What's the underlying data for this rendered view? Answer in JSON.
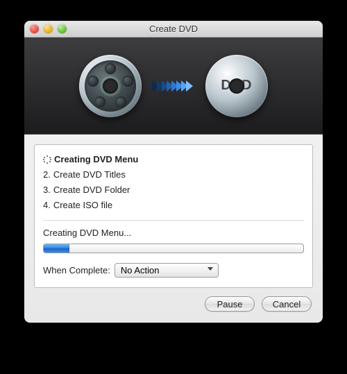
{
  "window": {
    "title": "Create DVD"
  },
  "hero": {
    "dvd_label": "DVD"
  },
  "steps": {
    "items": [
      {
        "prefix": "",
        "label": "Creating DVD Menu",
        "active": true
      },
      {
        "prefix": "2.",
        "label": "Create DVD Titles",
        "active": false
      },
      {
        "prefix": "3.",
        "label": "Create DVD Folder",
        "active": false
      },
      {
        "prefix": "4.",
        "label": "Create ISO file",
        "active": false
      }
    ]
  },
  "status": "Creating DVD Menu...",
  "progress_percent": 10,
  "complete": {
    "label": "When Complete:",
    "selected": "No Action"
  },
  "buttons": {
    "pause": "Pause",
    "cancel": "Cancel"
  }
}
